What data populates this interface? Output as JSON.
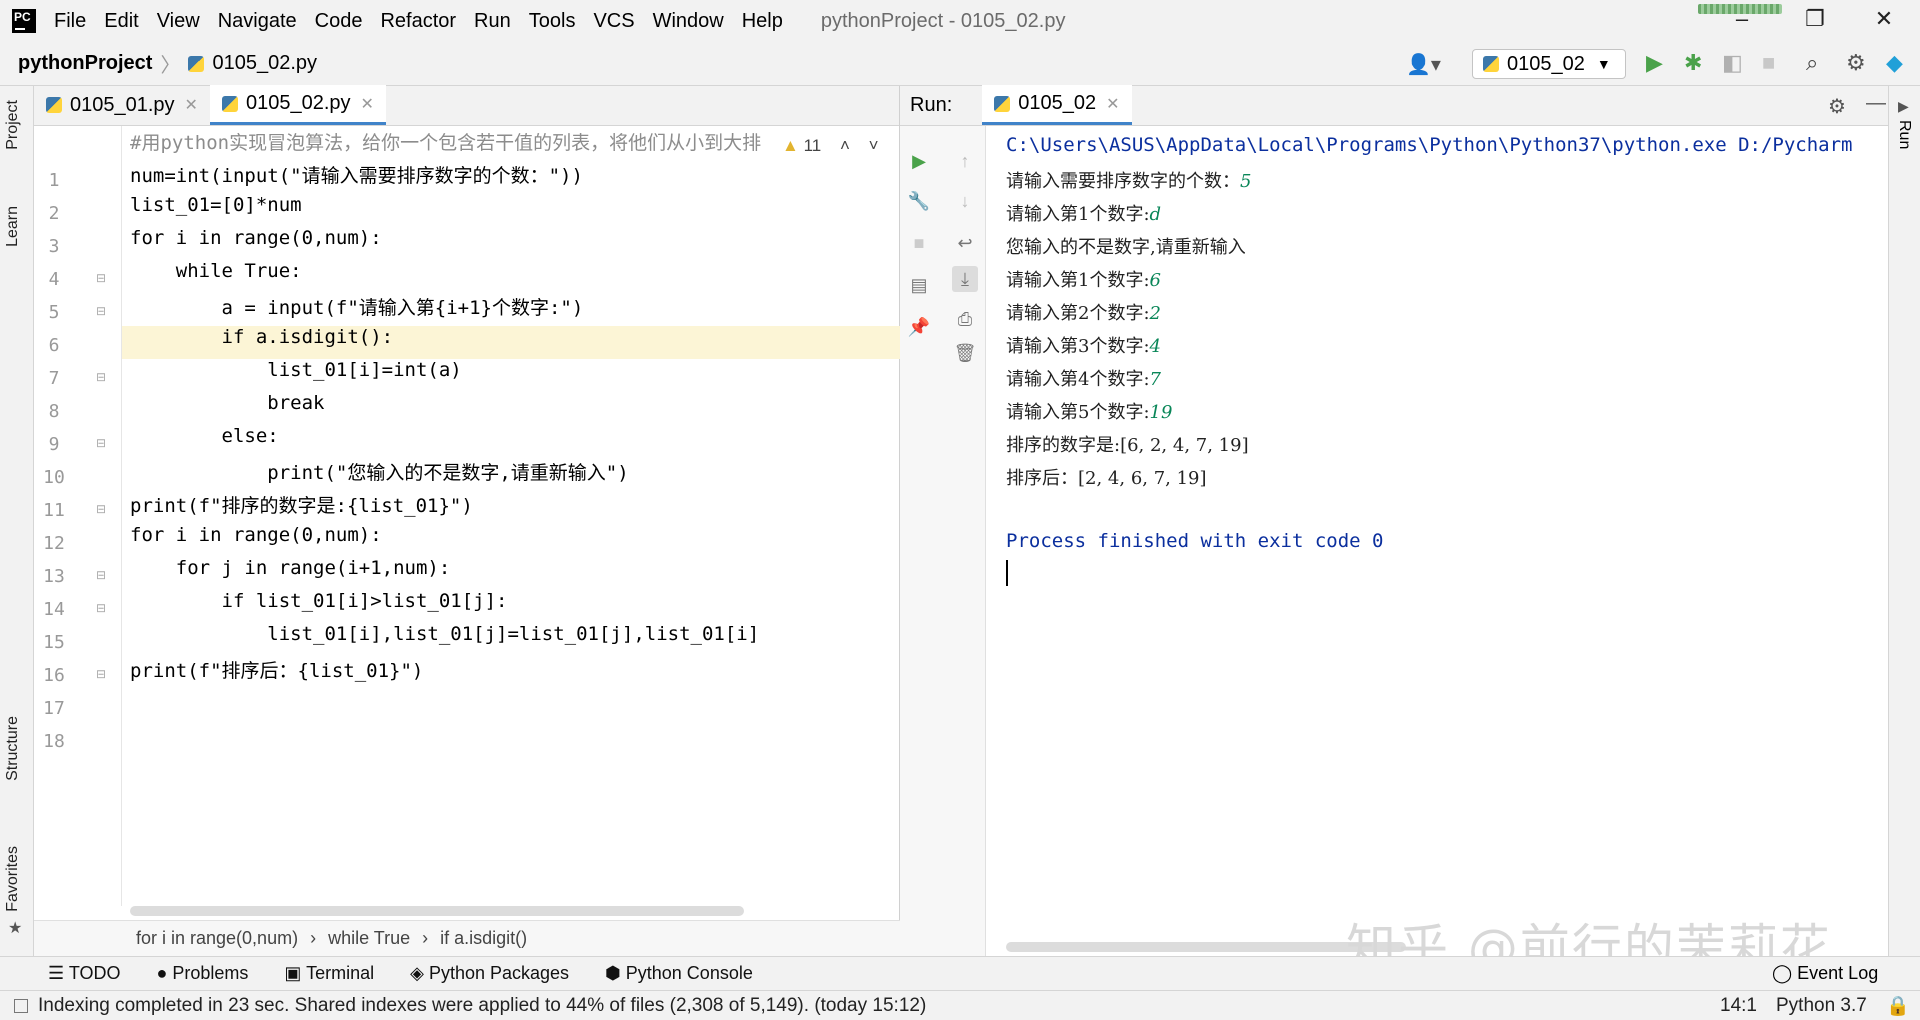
{
  "menu": [
    "File",
    "Edit",
    "View",
    "Navigate",
    "Code",
    "Refactor",
    "Run",
    "Tools",
    "VCS",
    "Window",
    "Help"
  ],
  "window_title": "pythonProject - 0105_02.py",
  "nav": {
    "project": "pythonProject",
    "file": "0105_02.py",
    "run_config": "0105_02"
  },
  "left_tabs": [
    "Project",
    "Learn",
    "Structure",
    "Favorites"
  ],
  "editor": {
    "tabs": [
      {
        "label": "0105_01.py"
      },
      {
        "label": "0105_02.py"
      }
    ],
    "warning_count": "11",
    "lines": [
      {
        "n": "1",
        "t": "#用python实现冒泡算法，给你一个包含若干值的列表，将他们从小到大排"
      },
      {
        "n": "2",
        "t": "num=int(input(\"请输入需要排序数字的个数：\"))"
      },
      {
        "n": "3",
        "t": "list_01=[0]*num"
      },
      {
        "n": "4",
        "t": "for i in range(0,num):"
      },
      {
        "n": "5",
        "t": "    while True:"
      },
      {
        "n": "6",
        "t": "        a = input(f\"请输入第{i+1}个数字:\")"
      },
      {
        "n": "7",
        "t": "        if a.isdigit():"
      },
      {
        "n": "8",
        "t": "            list_01[i]=int(a)"
      },
      {
        "n": "9",
        "t": "            break"
      },
      {
        "n": "10",
        "t": "        else:"
      },
      {
        "n": "11",
        "t": "            print(\"您输入的不是数字,请重新输入\")"
      },
      {
        "n": "12",
        "t": "print(f\"排序的数字是:{list_01}\")"
      },
      {
        "n": "13",
        "t": "for i in range(0,num):"
      },
      {
        "n": "14",
        "t": "    for j in range(i+1,num):"
      },
      {
        "n": "15",
        "t": "        if list_01[i]>list_01[j]:"
      },
      {
        "n": "16",
        "t": "            list_01[i],list_01[j]=list_01[j],list_01[i]"
      },
      {
        "n": "17",
        "t": "print(f\"排序后：{list_01}\")"
      },
      {
        "n": "18",
        "t": ""
      }
    ],
    "breadcrumb": [
      "for i in range(0,num)",
      "while True",
      "if a.isdigit()"
    ]
  },
  "run": {
    "label": "Run:",
    "tab": "0105_02",
    "console": [
      {
        "text": "C:\\Users\\ASUS\\AppData\\Local\\Programs\\Python\\Python37\\python.exe D:/Pycharm",
        "input": ""
      },
      {
        "text": "请输入需要排序数字的个数：",
        "input": "5"
      },
      {
        "text": "请输入第1个数字:",
        "input": "d"
      },
      {
        "text": "您输入的不是数字,请重新输入",
        "input": ""
      },
      {
        "text": "请输入第1个数字:",
        "input": "6"
      },
      {
        "text": "请输入第2个数字:",
        "input": "2"
      },
      {
        "text": "请输入第3个数字:",
        "input": "4"
      },
      {
        "text": "请输入第4个数字:",
        "input": "7"
      },
      {
        "text": "请输入第5个数字:",
        "input": "19"
      },
      {
        "text": "排序的数字是:[6, 2, 4, 7, 19]",
        "input": ""
      },
      {
        "text": "排序后：[2, 4, 6, 7, 19]",
        "input": ""
      },
      {
        "text": "",
        "input": ""
      },
      {
        "text": "Process finished with exit code 0",
        "input": ""
      }
    ]
  },
  "right_tab": "Run",
  "bottom_tabs": [
    "TODO",
    "Problems",
    "Terminal",
    "Python Packages",
    "Python Console"
  ],
  "event_log": "Event Log",
  "status": {
    "message": "Indexing completed in 23 sec. Shared indexes were applied to 44% of files (2,308 of 5,149). (today 15:12)",
    "position": "14:1",
    "interpreter": "Python 3.7"
  },
  "watermark": "知乎 @前行的茉莉花"
}
